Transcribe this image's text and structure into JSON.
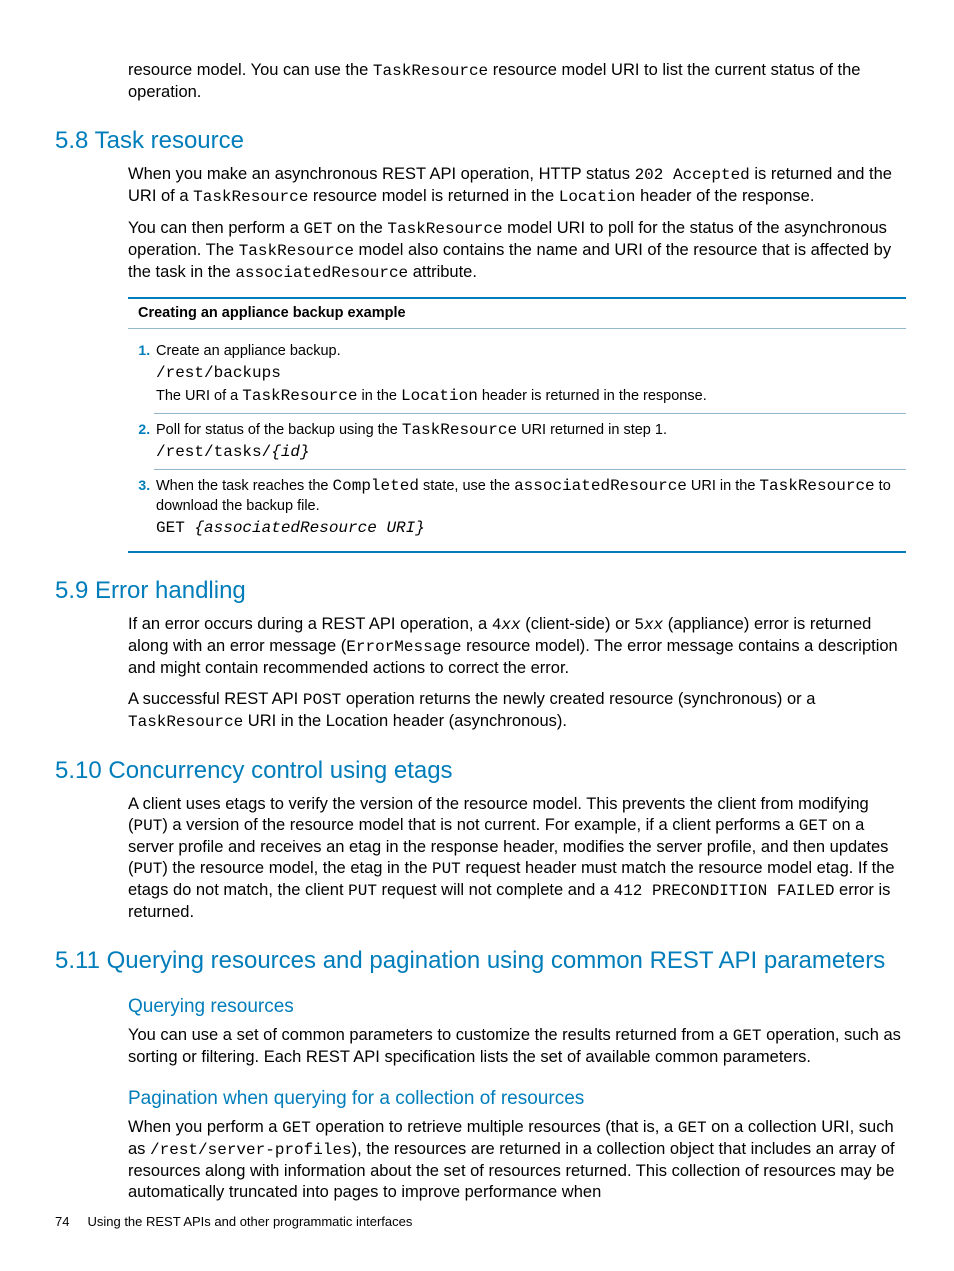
{
  "intro_cont": {
    "pre": "resource model. You can use the ",
    "c1": "TaskResource",
    "post": " resource model URI to list the current status of the operation."
  },
  "s58": {
    "heading": "5.8 Task resource",
    "p1": {
      "a": "When you make an asynchronous REST API operation, HTTP status ",
      "c1": "202 Accepted",
      "b": " is returned and the URI of a ",
      "c2": "TaskResource",
      "c": " resource model is returned in the ",
      "c3": "Location",
      "d": " header of the response."
    },
    "p2": {
      "a": "You can then perform a ",
      "c1": "GET",
      "b": " on the ",
      "c2": "TaskResource",
      "c": " model URI to poll for the status of the asynchronous operation. The ",
      "c3": "TaskResource",
      "d": " model also contains the name and URI of the resource that is affected by the task in the ",
      "c4": "associatedResource",
      "e": " attribute."
    },
    "example": {
      "title": "Creating an appliance backup example",
      "step1": {
        "t": "Create an appliance backup.",
        "code": "/rest/backups",
        "note_a": "The URI of a ",
        "note_c1": "TaskResource",
        "note_b": " in the ",
        "note_c2": "Location",
        "note_c": " header is returned in the response."
      },
      "step2": {
        "a": "Poll for status of the backup using the ",
        "c1": "TaskResource",
        "b": " URI returned in step 1.",
        "code": "/rest/tasks/",
        "code_i": "{id}"
      },
      "step3": {
        "a": "When the task reaches the ",
        "c1": "Completed",
        "b": " state, use the ",
        "c2": "associatedResource",
        "c": " URI in the ",
        "c3": "TaskResource",
        "d": " to download the backup file.",
        "code": "GET ",
        "code_i": "{associatedResource URI}"
      }
    }
  },
  "s59": {
    "heading": "5.9 Error handling",
    "p1": {
      "a": "If an error occurs during a REST API operation, a ",
      "c1": "4",
      "i1": "xx",
      "b": " (client-side) or ",
      "c2": "5",
      "i2": "xx",
      "c": " (appliance) error is returned along with an error message (",
      "c3": "ErrorMessage",
      "d": " resource model). The error message contains a description and might contain recommended actions to correct the error."
    },
    "p2": {
      "a": "A successful REST API ",
      "c1": "POST",
      "b": " operation returns the newly created resource (synchronous) or a ",
      "c2": "TaskResource",
      "c": " URI in the Location header (asynchronous)."
    }
  },
  "s510": {
    "heading": "5.10 Concurrency control using etags",
    "p1": {
      "a": "A client uses etags to verify the version of the resource model. This prevents the client from modifying (",
      "c1": "PUT",
      "b": ") a version of the resource model that is not current. For example, if a client performs a ",
      "c2": "GET",
      "c": " on a server profile and receives an etag in the response header, modifies the server profile, and then updates (",
      "c3": "PUT",
      "d": ") the resource model, the etag in the ",
      "c4": "PUT",
      "e": " request header must match the resource model etag. If the etags do not match, the client ",
      "c5": "PUT",
      "f": " request will not complete and a ",
      "c6": "412 PRECONDITION FAILED",
      "g": " error is returned."
    }
  },
  "s511": {
    "heading": "5.11 Querying resources and pagination using common REST API parameters",
    "sub1": {
      "heading": "Querying resources",
      "p": {
        "a": "You can use a set of common parameters to customize the results returned from a ",
        "c1": "GET",
        "b": " operation, such as sorting or filtering. Each REST API specification lists the set of available common parameters."
      }
    },
    "sub2": {
      "heading": "Pagination when querying for a collection of resources",
      "p": {
        "a": "When you perform a ",
        "c1": "GET",
        "b": " operation to retrieve multiple resources (that is, a ",
        "c2": "GET",
        "c": " on a collection URI, such as ",
        "c3": "/rest/server-profiles",
        "d": "), the resources are returned in a collection object that includes an array of resources along with information about the set of resources returned. This collection of resources may be automatically truncated into pages to improve performance when"
      }
    }
  },
  "footer": {
    "page": "74",
    "title": "Using the REST APIs and other programmatic interfaces"
  }
}
